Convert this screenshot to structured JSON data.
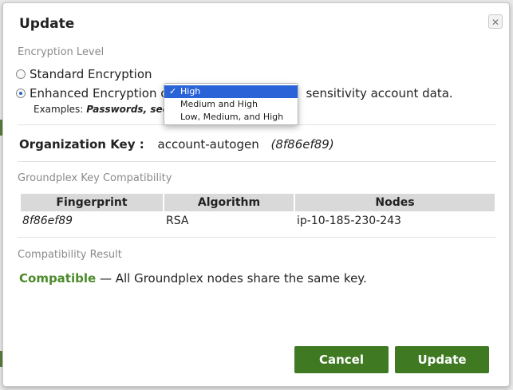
{
  "dialog": {
    "title": "Update",
    "close_glyph": "✕"
  },
  "encryption": {
    "section_label": "Encryption Level",
    "standard_label": "Standard Encryption",
    "enhanced_prefix": "Enhanced Encryption o",
    "enhanced_suffix": "sensitivity account data.",
    "examples_label": "Examples:",
    "examples_values": "Passwords, secre"
  },
  "dropdown": {
    "options": [
      "High",
      "Medium and High",
      "Low, Medium, and High"
    ],
    "selected": "High",
    "check_glyph": "✓"
  },
  "org_key": {
    "label": "Organization Key :",
    "value": "account-autogen",
    "hash": "(8f86ef89)"
  },
  "compat": {
    "section_label": "Groundplex Key Compatibility",
    "columns": [
      "Fingerprint",
      "Algorithm",
      "Nodes"
    ],
    "rows": [
      {
        "fingerprint": "8f86ef89",
        "algorithm": "RSA",
        "nodes": "ip-10-185-230-243"
      }
    ]
  },
  "result": {
    "section_label": "Compatibility Result",
    "status": "Compatible",
    "message": "— All Groundplex nodes share the same key."
  },
  "buttons": {
    "cancel": "Cancel",
    "update": "Update"
  },
  "colors": {
    "accent": "#3f7a22",
    "selection": "#2a63d8",
    "compatible": "#4a8a2a"
  }
}
